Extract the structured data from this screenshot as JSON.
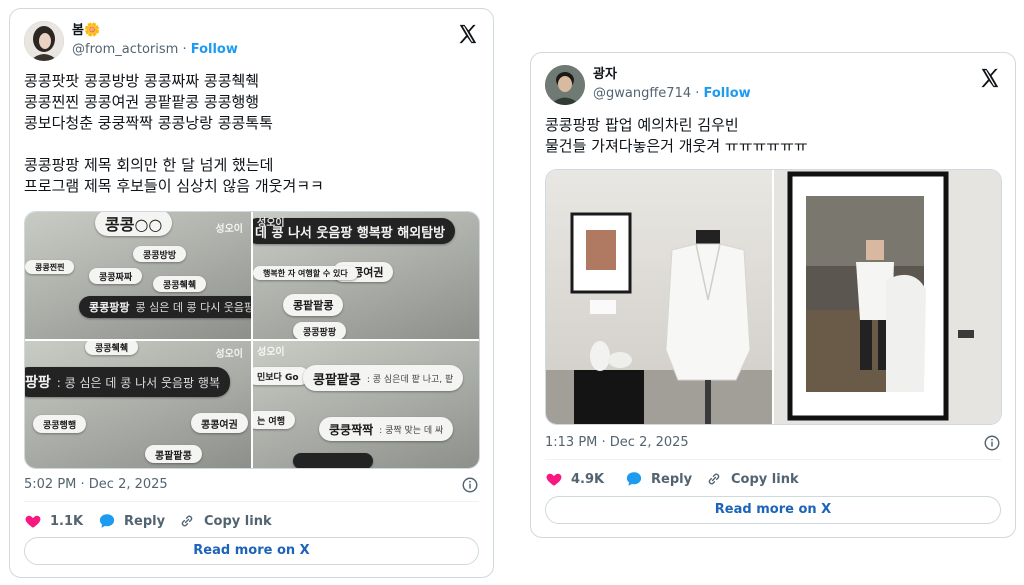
{
  "tweet1": {
    "display_name": "봄",
    "emoji": "🌼",
    "handle": "@from_actorism",
    "follow_label": "Follow",
    "text": "콩콩팟팟 콩콩방방 콩콩짜짜 콩콩췍췍\n콩콩찐찐 콩콩여권 콩팥팥콩 콩콩행행\n콩보다청춘 쿵쿵짝짝 콩콩낭랑 콩콩톡톡\n\n콩콩팡팡 제목 회의만 한 달 넘게 했는데\n프로그램 제목 후보들이 심상치 않음 개웃겨ㅋㅋ",
    "timestamp": "5:02 PM · Dec 2, 2025",
    "likes": "1.1K",
    "reply_label": "Reply",
    "copy_label": "Copy link",
    "read_more": "Read more on X",
    "images": {
      "tl": {
        "watermark": "성오이",
        "signs": [
          "콩콩○○",
          "콩콩방방",
          "콩콩짜짜",
          "콩콩찐찐",
          "콩콩췍췍",
          "콩콩팡팡",
          "콩 심은 데 콩 다시 웃음팡"
        ]
      },
      "tr": {
        "watermark": "성오이",
        "signs": [
          "데 콩 나서 웃음팡 행복팡 해외탐방",
          "콩콩여권",
          "콩팥팥콩",
          "콩콩팡팡",
          "행복한 자 여행할 수 있다"
        ]
      },
      "bl": {
        "watermark": "성오이",
        "signs": [
          "콩콩췍췍",
          "팡팡",
          ": 콩 심은 데 콩 나서 웃음팡 행복",
          "콩콩행행",
          "콩콩여권",
          "콩팥팥콩"
        ]
      },
      "br": {
        "watermark": "성오이",
        "signs": [
          "민보다 Go",
          "콩팥팥콩",
          ": 콩 심은데 팥 나고, 팥",
          "는 여행",
          "쿵쿵짝짝",
          ": 쿵짝 맞는 데 싸"
        ]
      }
    }
  },
  "tweet2": {
    "display_name": "광자",
    "handle": "@gwangffe714",
    "follow_label": "Follow",
    "text": "콩콩팡팡 팝업 예의차린 김우빈\n물건들 가져다놓은거 개웃겨 ㅠㅠㅠㅠㅠㅠ",
    "timestamp": "1:13 PM · Dec 2, 2025",
    "likes": "4.9K",
    "reply_label": "Reply",
    "copy_label": "Copy link",
    "read_more": "Read more on X"
  },
  "colors": {
    "accent": "#1d9bf0",
    "like": "#f91880",
    "text": "#0f1419",
    "muted": "#536471",
    "border": "#cfd9de"
  },
  "icons": [
    "x-logo-icon",
    "info-icon",
    "heart-icon",
    "reply-icon",
    "link-icon"
  ]
}
